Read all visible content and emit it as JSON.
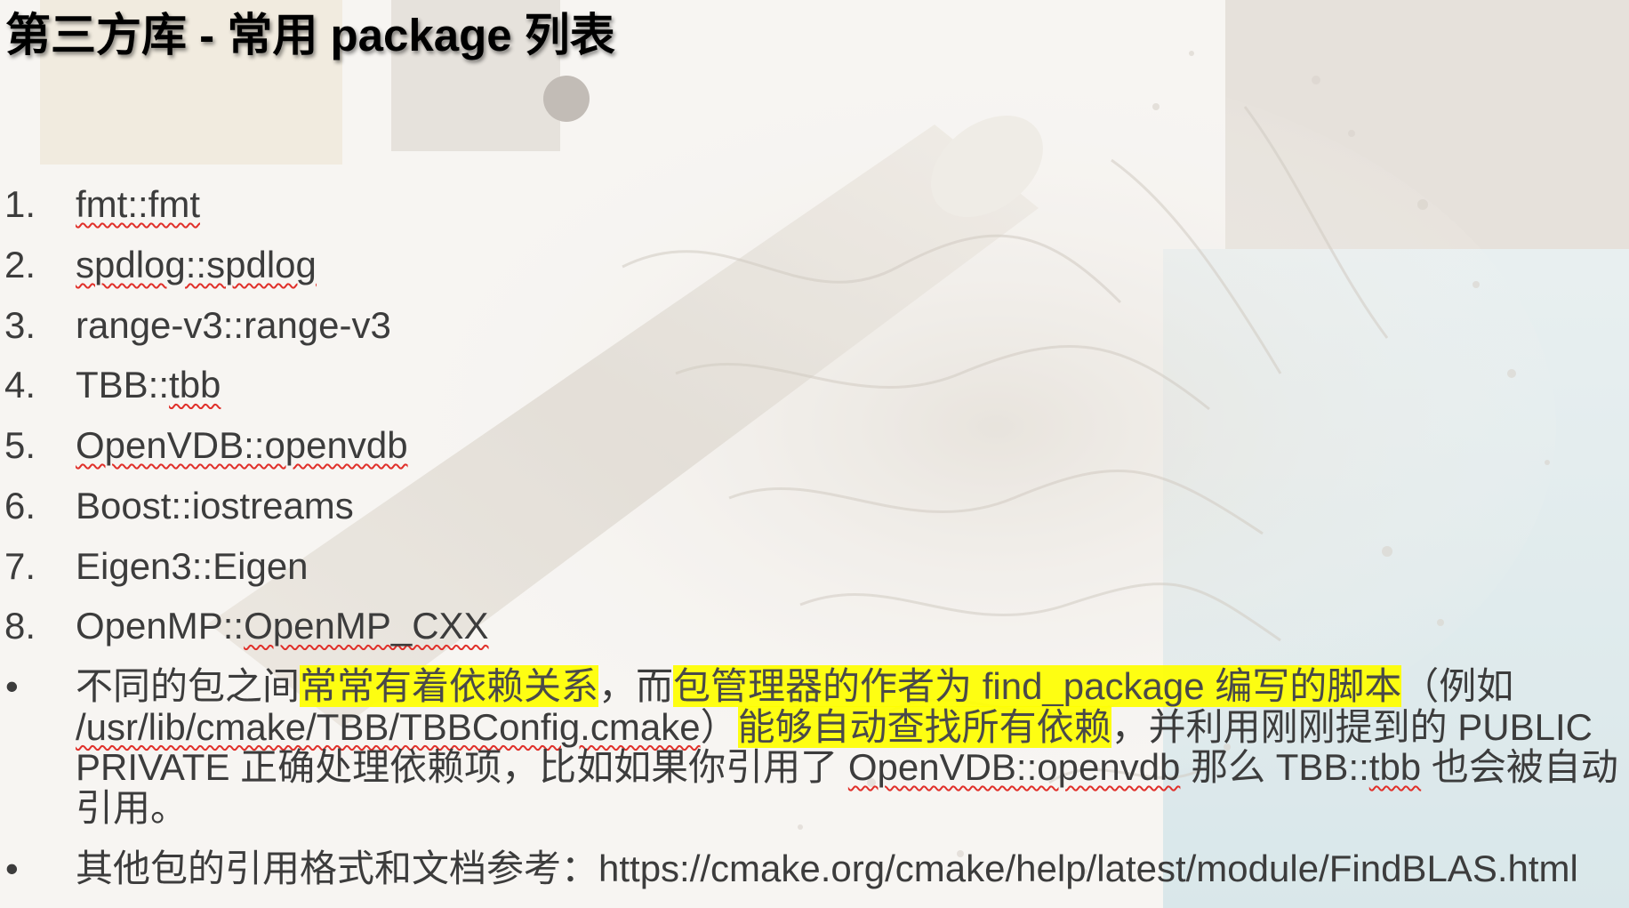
{
  "slide": {
    "title": "第三方库 - 常用 package 列表"
  },
  "list": [
    {
      "num": "1.",
      "parts": [
        "fmt::fmt"
      ]
    },
    {
      "num": "2.",
      "parts": [
        "spdlog::spdlog"
      ]
    },
    {
      "num": "3.",
      "parts": [
        "range-v3::range-v3"
      ]
    },
    {
      "num": "4.",
      "parts": [
        "TBB::",
        "tbb"
      ]
    },
    {
      "num": "5.",
      "parts": [
        "OpenVDB::openvdb"
      ]
    },
    {
      "num": "6.",
      "parts": [
        "Boost::iostreams"
      ]
    },
    {
      "num": "7.",
      "parts": [
        "Eigen3::Eigen"
      ]
    },
    {
      "num": "8.",
      "parts": [
        "OpenMP::",
        "OpenMP_CXX"
      ]
    }
  ],
  "bullets": [
    {
      "marker": "•",
      "parts": [
        "不同的包之间",
        "常常有着依赖关系",
        "，而",
        "包管理器的作者为 find_package 编写的脚本",
        "（例如 ",
        "/usr/lib/cmake/TBB/TBBConfig.cmake",
        "）",
        "能够自动查找所有依赖",
        "，并利用刚刚提到的 PUBLIC PRIVATE 正确处理依赖项，比如如果你引用了 ",
        "OpenVDB::openvdb",
        " 那么 TBB::",
        "tbb",
        " 也会被自动引用。"
      ]
    },
    {
      "marker": "•",
      "parts": [
        "其他包的引用格式和文档参考：https://cmake.org/cmake/help/latest/module/FindBLAS.html"
      ]
    }
  ],
  "colors": {
    "text": "#3c3c3c",
    "title": "#000000",
    "highlight": "#ffff00",
    "spellcheck_underline": "#e0302a"
  }
}
